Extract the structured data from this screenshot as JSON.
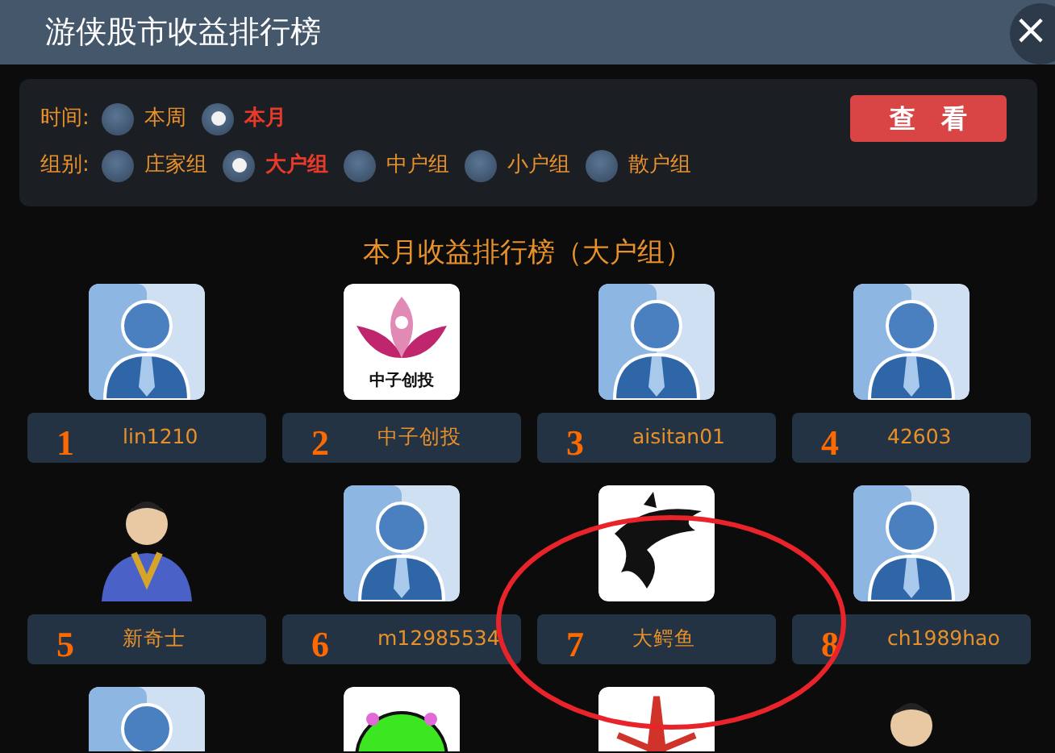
{
  "window": {
    "title": "游侠股市收益排行榜",
    "close": "×"
  },
  "filters": {
    "time": {
      "label": "时间:",
      "options": [
        {
          "label": "本周",
          "selected": false
        },
        {
          "label": "本月",
          "selected": true
        }
      ]
    },
    "group": {
      "label": "组别:",
      "options": [
        {
          "label": "庄家组",
          "selected": false
        },
        {
          "label": "大户组",
          "selected": true
        },
        {
          "label": "中户组",
          "selected": false
        },
        {
          "label": "小户组",
          "selected": false
        },
        {
          "label": "散户组",
          "selected": false
        }
      ]
    },
    "button": "查　看"
  },
  "heading": "本月收益排行榜（大户组）",
  "ranking": [
    {
      "rank": "1",
      "name": "lin1210",
      "kind": "default"
    },
    {
      "rank": "2",
      "name": "中子创投",
      "kind": "lotus",
      "avatar_text": "中子创投"
    },
    {
      "rank": "3",
      "name": "aisitan01",
      "kind": "default"
    },
    {
      "rank": "4",
      "name": "42603",
      "kind": "default"
    },
    {
      "rank": "5",
      "name": "新奇士",
      "kind": "portrait"
    },
    {
      "rank": "6",
      "name": "m12985534",
      "kind": "default"
    },
    {
      "rank": "7",
      "name": "大鳄鱼",
      "kind": "dragon"
    },
    {
      "rank": "8",
      "name": "ch1989hao",
      "kind": "default"
    }
  ],
  "ranking_partial": [
    {
      "kind": "default"
    },
    {
      "kind": "green"
    },
    {
      "kind": "emblem"
    },
    {
      "kind": "portrait"
    }
  ],
  "annotation": {
    "kind": "ellipse",
    "color": "#e8242a"
  }
}
